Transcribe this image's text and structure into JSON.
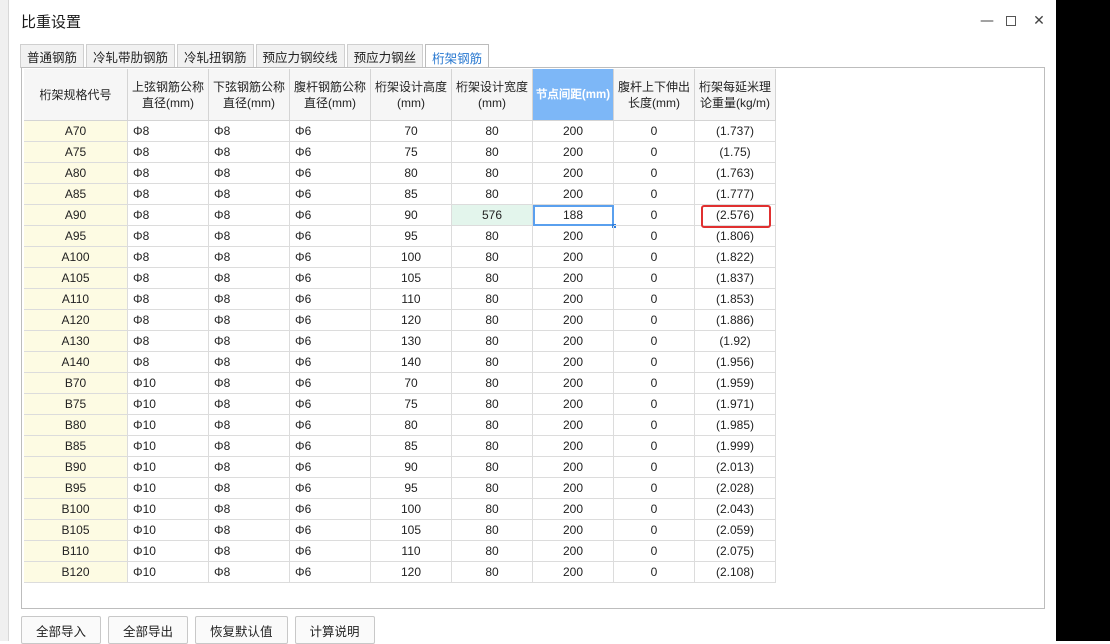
{
  "window": {
    "title": "比重设置",
    "min_label": "—",
    "close_label": "✕"
  },
  "tabs": [
    {
      "label": "普通钢筋",
      "active": false
    },
    {
      "label": "冷轧带肋钢筋",
      "active": false
    },
    {
      "label": "冷轧扭钢筋",
      "active": false
    },
    {
      "label": "预应力钢绞线",
      "active": false
    },
    {
      "label": "预应力钢丝",
      "active": false
    },
    {
      "label": "桁架钢筋",
      "active": true
    }
  ],
  "table": {
    "headers": [
      "桁架规格代号",
      "上弦钢筋公称直径(mm)",
      "下弦钢筋公称直径(mm)",
      "腹杆钢筋公称直径(mm)",
      "桁架设计高度(mm)",
      "桁架设计宽度(mm)",
      "节点间距(mm)",
      "腹杆上下伸出长度(mm)",
      "桁架每延米理论重量(kg/m)"
    ],
    "selected_header_index": 6,
    "rows": [
      [
        "A70",
        "Φ8",
        "Φ8",
        "Φ6",
        "70",
        "80",
        "200",
        "0",
        "(1.737)"
      ],
      [
        "A75",
        "Φ8",
        "Φ8",
        "Φ6",
        "75",
        "80",
        "200",
        "0",
        "(1.75)"
      ],
      [
        "A80",
        "Φ8",
        "Φ8",
        "Φ6",
        "80",
        "80",
        "200",
        "0",
        "(1.763)"
      ],
      [
        "A85",
        "Φ8",
        "Φ8",
        "Φ6",
        "85",
        "80",
        "200",
        "0",
        "(1.777)"
      ],
      [
        "A90",
        "Φ8",
        "Φ8",
        "Φ6",
        "90",
        "576",
        "188",
        "0",
        "(2.576)"
      ],
      [
        "A95",
        "Φ8",
        "Φ8",
        "Φ6",
        "95",
        "80",
        "200",
        "0",
        "(1.806)"
      ],
      [
        "A100",
        "Φ8",
        "Φ8",
        "Φ6",
        "100",
        "80",
        "200",
        "0",
        "(1.822)"
      ],
      [
        "A105",
        "Φ8",
        "Φ8",
        "Φ6",
        "105",
        "80",
        "200",
        "0",
        "(1.837)"
      ],
      [
        "A110",
        "Φ8",
        "Φ8",
        "Φ6",
        "110",
        "80",
        "200",
        "0",
        "(1.853)"
      ],
      [
        "A120",
        "Φ8",
        "Φ8",
        "Φ6",
        "120",
        "80",
        "200",
        "0",
        "(1.886)"
      ],
      [
        "A130",
        "Φ8",
        "Φ8",
        "Φ6",
        "130",
        "80",
        "200",
        "0",
        "(1.92)"
      ],
      [
        "A140",
        "Φ8",
        "Φ8",
        "Φ6",
        "140",
        "80",
        "200",
        "0",
        "(1.956)"
      ],
      [
        "B70",
        "Φ10",
        "Φ8",
        "Φ6",
        "70",
        "80",
        "200",
        "0",
        "(1.959)"
      ],
      [
        "B75",
        "Φ10",
        "Φ8",
        "Φ6",
        "75",
        "80",
        "200",
        "0",
        "(1.971)"
      ],
      [
        "B80",
        "Φ10",
        "Φ8",
        "Φ6",
        "80",
        "80",
        "200",
        "0",
        "(1.985)"
      ],
      [
        "B85",
        "Φ10",
        "Φ8",
        "Φ6",
        "85",
        "80",
        "200",
        "0",
        "(1.999)"
      ],
      [
        "B90",
        "Φ10",
        "Φ8",
        "Φ6",
        "90",
        "80",
        "200",
        "0",
        "(2.013)"
      ],
      [
        "B95",
        "Φ10",
        "Φ8",
        "Φ6",
        "95",
        "80",
        "200",
        "0",
        "(2.028)"
      ],
      [
        "B100",
        "Φ10",
        "Φ8",
        "Φ6",
        "100",
        "80",
        "200",
        "0",
        "(2.043)"
      ],
      [
        "B105",
        "Φ10",
        "Φ8",
        "Φ6",
        "105",
        "80",
        "200",
        "0",
        "(2.059)"
      ],
      [
        "B110",
        "Φ10",
        "Φ8",
        "Φ6",
        "110",
        "80",
        "200",
        "0",
        "(2.075)"
      ],
      [
        "B120",
        "Φ10",
        "Φ8",
        "Φ6",
        "120",
        "80",
        "200",
        "0",
        "(2.108)"
      ]
    ],
    "edited_cells": [
      [
        4,
        5
      ]
    ],
    "active_cell": [
      4,
      6
    ],
    "highlighted_cell": [
      4,
      8
    ]
  },
  "buttons": {
    "import_all": "全部导入",
    "export_all": "全部导出",
    "restore_default": "恢复默认值",
    "calc_info": "计算说明"
  },
  "colors": {
    "tab_active_text": "#2878d0",
    "header_selected_bg": "#7db7f7",
    "code_column_bg": "#fdfbe3",
    "edited_cell_bg": "#e3f5ec",
    "highlight_border": "#e03030"
  }
}
